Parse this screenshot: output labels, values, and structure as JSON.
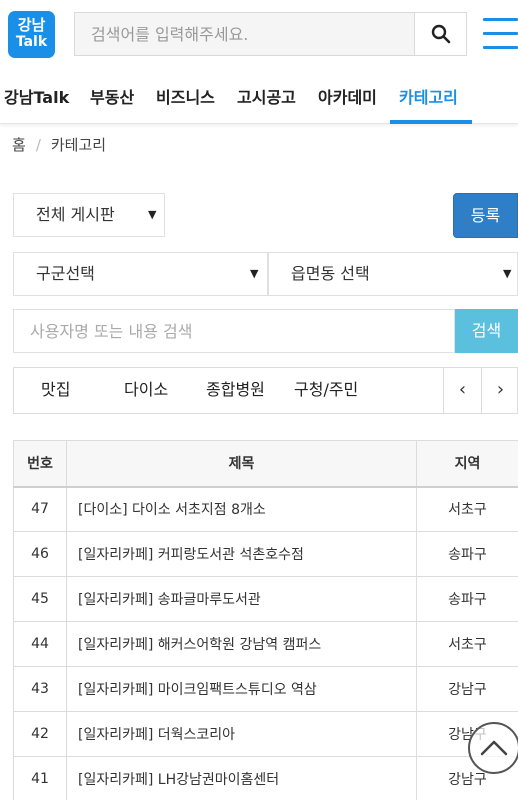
{
  "header": {
    "logo_line1": "강남",
    "logo_line2": "Talk",
    "search_placeholder": "검색어를 입력해주세요.",
    "search_icon": "search-icon",
    "menu_icon": "hamburger-menu-icon",
    "accent_color": "#1a8fe8"
  },
  "nav": {
    "items": [
      "강남Talk",
      "부동산",
      "비즈니스",
      "고시공고",
      "아카데미",
      "카테고리"
    ],
    "active": "카테고리"
  },
  "breadcrumb": {
    "home": "홈",
    "separator": "/",
    "current": "카테고리"
  },
  "filters": {
    "board_select": "전체 게시판",
    "district_select": "구군선택",
    "dong_select": "읍면동 선택",
    "register_label": "등록",
    "user_search_placeholder": "사용자명 또는 내용 검색",
    "search_label": "검색"
  },
  "categories": {
    "items": [
      "맛집",
      "다이소",
      "종합병원",
      "구청/주민"
    ],
    "prev_icon": "chevron-left-icon",
    "next_icon": "chevron-right-icon"
  },
  "table": {
    "headers": [
      "번호",
      "제목",
      "지역"
    ],
    "rows": [
      {
        "num": "47",
        "title": "[다이소] 다이소 서초지점 8개소",
        "region": "서초구"
      },
      {
        "num": "46",
        "title": "[일자리카페] 커피랑도서관 석촌호수점",
        "region": "송파구"
      },
      {
        "num": "45",
        "title": "[일자리카페] 송파글마루도서관",
        "region": "송파구"
      },
      {
        "num": "44",
        "title": "[일자리카페] 해커스어학원 강남역 캠퍼스",
        "region": "서초구"
      },
      {
        "num": "43",
        "title": "[일자리카페] 마이크임팩트스튜디오 역삼",
        "region": "강남구"
      },
      {
        "num": "42",
        "title": "[일자리카페] 더웍스코리아",
        "region": "강남구"
      },
      {
        "num": "41",
        "title": "[일자리카페] LH강남권마이홈센터",
        "region": "강남구"
      }
    ]
  },
  "scroll_top_icon": "chevron-up-icon"
}
